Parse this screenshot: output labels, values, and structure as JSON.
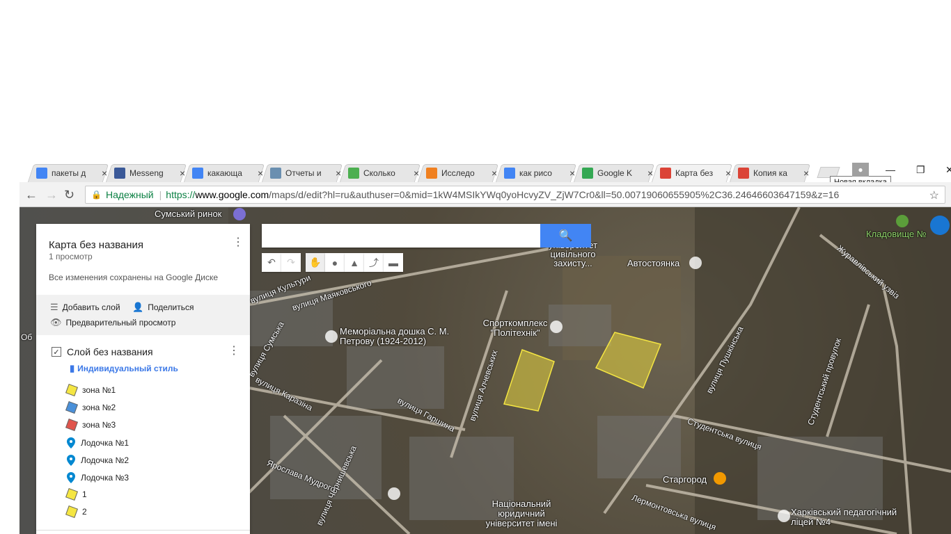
{
  "browser": {
    "tabs": [
      {
        "title": "пакеты д",
        "favicon": "google-icon",
        "color": "#4285f4",
        "active": false
      },
      {
        "title": "Messeng",
        "favicon": "facebook-icon",
        "color": "#3b5998",
        "active": false
      },
      {
        "title": "какающа",
        "favicon": "google-icon",
        "color": "#4285f4",
        "active": false
      },
      {
        "title": "Отчеты и",
        "favicon": "dog-icon",
        "color": "#6a8fb0",
        "active": false
      },
      {
        "title": "Сколько",
        "favicon": "paw-icon",
        "color": "#4caf50",
        "active": false
      },
      {
        "title": "Исследо",
        "favicon": "gfk-icon",
        "color": "#f08020",
        "active": false
      },
      {
        "title": "как рисо",
        "favicon": "google-icon",
        "color": "#4285f4",
        "active": false
      },
      {
        "title": "Google K",
        "favicon": "maps-icon",
        "color": "#34a853",
        "active": false
      },
      {
        "title": "Карта без",
        "favicon": "mymaps-icon",
        "color": "#db4437",
        "active": true
      },
      {
        "title": "Копия ка",
        "favicon": "mymaps-icon",
        "color": "#db4437",
        "active": false
      }
    ],
    "new_tab_tooltip": "Новая вкладка",
    "secure_label": "Надежный",
    "url_scheme": "https://",
    "url_host": "www.google.com",
    "url_path": "/maps/d/edit?hl=ru&authuser=0&mid=1kW4MSIkYWq0yoHcvyZV_ZjW7Cr0&ll=50.00719060655905%2C36.24646603647159&z=16"
  },
  "map": {
    "search_placeholder": "",
    "labels": [
      "Сумський ринок",
      "Автостоянка",
      "Спорткомплекс \"Політехнік\"",
      "Меморіальна дошка С. М. Петрову (1924-2012)",
      "Кладовище №",
      "Старгород",
      "Національний юридичний університет імені",
      "Харківський педагогічний ліцей №4",
      "університет цивільного захисту..."
    ],
    "streets": [
      "вулиця Маяковського",
      "вулиця Культури",
      "вулиця Сумська",
      "вулиця Каразіна",
      "вулиця Гаршина",
      "вулиця Алчевських",
      "вулиця Пушкінська",
      "Студентська вулиця",
      "Студентський провулок",
      "Журавлівський узвіз",
      "Лермонтовська вулиця",
      "вулиця Чернишевська",
      "Ярослава Мудрого",
      "Об"
    ],
    "polygon_color": "#e8d640"
  },
  "panel": {
    "title": "Карта без названия",
    "views": "1 просмотр",
    "saved": "Все изменения сохранены на Google Диске",
    "add_layer": "Добавить слой",
    "share": "Поделиться",
    "preview": "Предварительный просмотр",
    "layer_name": "Слой без названия",
    "style_link": "Индивидуальный стиль",
    "items": [
      {
        "label": "зона №1",
        "type": "polygon",
        "color": "#f5e642"
      },
      {
        "label": "зона №2",
        "type": "polygon",
        "color": "#4a90d9"
      },
      {
        "label": "зона №3",
        "type": "polygon",
        "color": "#e0544c"
      },
      {
        "label": "Лодочка №1",
        "type": "pin",
        "color": "#0288d1"
      },
      {
        "label": "Лодочка №2",
        "type": "pin",
        "color": "#0288d1"
      },
      {
        "label": "Лодочка №3",
        "type": "pin",
        "color": "#0288d1"
      },
      {
        "label": "1",
        "type": "polygon",
        "color": "#f5e642"
      },
      {
        "label": "2",
        "type": "polygon",
        "color": "#f5e642"
      }
    ]
  }
}
